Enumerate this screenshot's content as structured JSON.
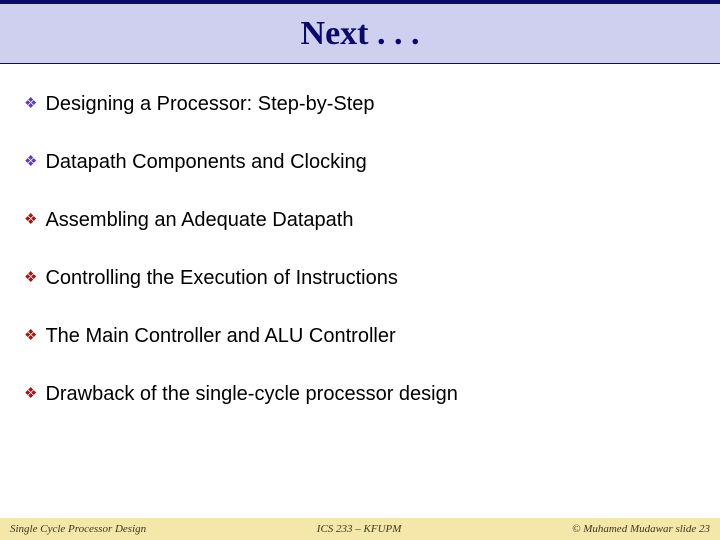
{
  "title": "Next . . .",
  "bullets": [
    {
      "text": "Designing a Processor: Step-by-Step",
      "done": true
    },
    {
      "text": "Datapath Components and Clocking",
      "done": true
    },
    {
      "text": "Assembling an Adequate Datapath",
      "done": false
    },
    {
      "text": "Controlling the Execution of Instructions",
      "done": false
    },
    {
      "text": "The Main Controller and ALU Controller",
      "done": false
    },
    {
      "text": "Drawback of the single-cycle processor design",
      "done": false
    }
  ],
  "footer": {
    "left": "Single Cycle Processor Design",
    "center": "ICS 233 – KFUPM",
    "right": "© Muhamed Mudawar  slide 23"
  },
  "icons": {
    "bullet_glyph": "❖"
  }
}
